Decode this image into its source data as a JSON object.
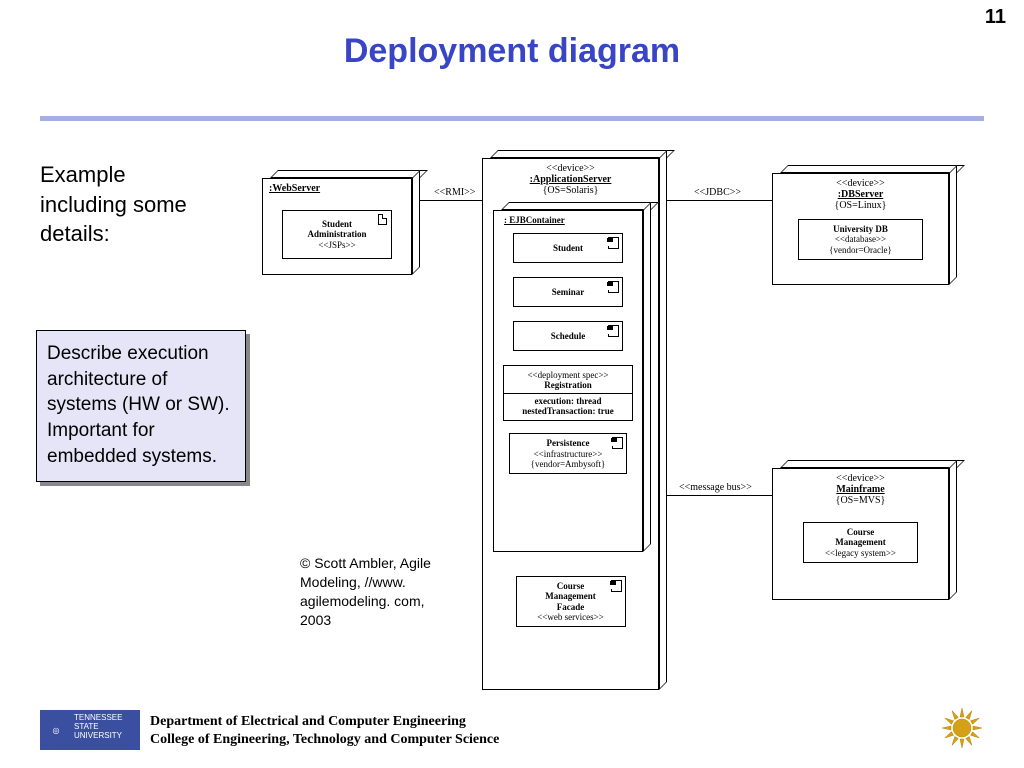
{
  "page_number": "11",
  "title": "Deployment diagram",
  "intro": "Example including some details:",
  "description": "Describe execution architecture of systems (HW or SW). Important for embedded systems.",
  "credit": "© Scott Ambler, Agile Modeling, //www. agilemodeling. com, 2003",
  "footer": {
    "line1": "Department of Electrical and Computer Engineering",
    "line2": "College of Engineering, Technology and Computer Science",
    "logo_text1": "TENNESSEE",
    "logo_text2": "STATE UNIVERSITY"
  },
  "diagram": {
    "connectors": {
      "rmi": "<<RMI>>",
      "jdbc": "<<JDBC>>",
      "msgbus": "<<message bus>>"
    },
    "webserver": {
      "name": ":WebServer",
      "inner": {
        "l1": "Student",
        "l2": "Administration",
        "l3": "<<JSPs>>"
      }
    },
    "appserver": {
      "stereo": "<<device>>",
      "name": ":ApplicationServer",
      "prop": "{OS=Solaris}",
      "ejb_name": ": EJBContainer",
      "comps": {
        "student": "Student",
        "seminar": "Seminar",
        "schedule": "Schedule"
      },
      "deploy": {
        "l1": "<<deployment spec>>",
        "l2": "Registration",
        "l3": "execution: thread",
        "l4": "nestedTransaction: true"
      },
      "persist": {
        "l1": "Persistence",
        "l2": "<<infrastructure>>",
        "l3": "{vendor=Ambysoft}"
      },
      "facade": {
        "l1": "Course",
        "l2": "Management",
        "l3": "Facade",
        "l4": "<<web services>>"
      }
    },
    "dbserver": {
      "stereo": "<<device>>",
      "name": ":DBServer",
      "prop": "{OS=Linux}",
      "inner": {
        "l1": "University DB",
        "l2": "<<database>>",
        "l3": "{vendor=Oracle}"
      }
    },
    "mainframe": {
      "stereo": "<<device>>",
      "name": "Mainframe",
      "prop": "{OS=MVS}",
      "inner": {
        "l1": "Course",
        "l2": "Management",
        "l3": "<<legacy system>>"
      }
    }
  }
}
